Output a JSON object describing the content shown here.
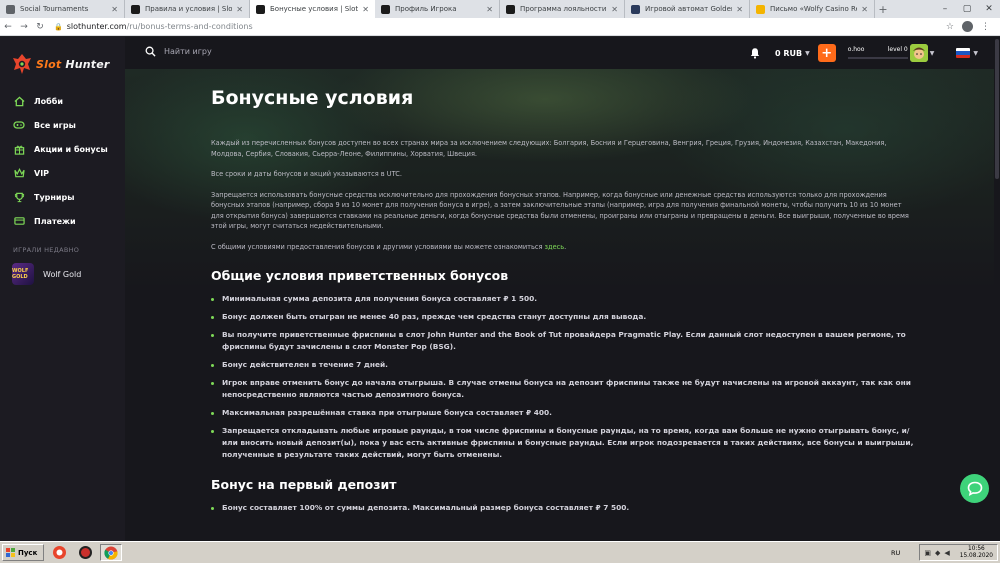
{
  "browser": {
    "tabs": [
      {
        "title": "Social Tournaments",
        "favicon": "social-favicon",
        "active": false
      },
      {
        "title": "Правила и условия | Slot Hunte",
        "favicon": "slothunter-favicon",
        "active": false
      },
      {
        "title": "Бонусные условия | Slot Hunte",
        "favicon": "slothunter-favicon",
        "active": true
      },
      {
        "title": "Профиль Игрока",
        "favicon": "slothunter-favicon",
        "active": false
      },
      {
        "title": "Программа лояльности | Slot H",
        "favicon": "slothunter-favicon",
        "active": false
      },
      {
        "title": "Игровой автомат Golden Grimo",
        "favicon": "game-favicon",
        "active": false
      },
      {
        "title": "Письмо «Wolfy Casino Received",
        "favicon": "mail-favicon",
        "active": false
      }
    ],
    "url_domain": "slothunter.com",
    "url_path": "/ru/bonus-terms-and-conditions"
  },
  "sidebar": {
    "logo_part1": "Slot",
    "logo_part2": " Hunter",
    "items": [
      {
        "label": "Лобби",
        "icon": "home-icon"
      },
      {
        "label": "Все игры",
        "icon": "gamepad-icon"
      },
      {
        "label": "Акции и бонусы",
        "icon": "gift-icon"
      },
      {
        "label": "VIP",
        "icon": "crown-icon"
      },
      {
        "label": "Турниры",
        "icon": "trophy-icon"
      },
      {
        "label": "Платежи",
        "icon": "wallet-icon"
      }
    ],
    "recent_heading": "ИГРАЛИ НЕДАВНО",
    "recent_game": "Wolf Gold",
    "recent_thumb_text": "WOLF GOLD"
  },
  "header": {
    "search_placeholder": "Найти игру",
    "balance": "0 RUB",
    "username": "o.hoo",
    "level": "level 0",
    "level_progress": 0
  },
  "content": {
    "title": "Бонусные условия",
    "paragraphs": [
      "Каждый из перечисленных бонусов доступен во всех странах мира за исключением следующих: Болгария, Босния и Герцеговина, Венгрия, Греция, Грузия, Индонезия, Казахстан, Македония, Молдова, Сербия, Словакия, Сьерра-Леоне, Филиппины, Хорватия, Швеция.",
      "Все сроки и даты бонусов и акций указываются в UTC.",
      "Запрещается использовать бонусные средства исключительно для прохождения бонусных этапов. Например, когда бонусные или денежные средства используются только для прохождения бонусных этапов (например, сбора 9 из 10 монет для получения бонуса в игре), а затем заключительные этапы (например, игра для получения финальной монеты, чтобы получить 10 из 10 монет для открытия бонуса) завершаются ставками на реальные деньги, когда бонусные средства были отменены, проиграны или отыграны и превращены в деньги. Все выигрыши, полученные во время этой игры, могут считаться недействительными."
    ],
    "link_sentence": "С общими условиями предоставления бонусов и другими условиями вы можете ознакомиться ",
    "link_text": "здесь",
    "link_end": ".",
    "section1_title": "Общие условия приветственных бонусов",
    "section1_items": [
      "Минимальная сумма депозита для получения бонуса составляет ₽ 1 500.",
      "Бонус должен быть отыгран не менее 40 раз, прежде чем средства станут доступны для вывода.",
      "Вы получите приветственные фриспины в слот John Hunter and the Book of Tut провайдера Pragmatic Play. Если данный слот недоступен в вашем регионе, то фриспины будут зачислены в слот Monster Pop (BSG).",
      "Бонус действителен в течение 7 дней.",
      "Игрок вправе отменить бонус до начала отыгрыша. В случае отмены бонуса на депозит фриспины также не будут начислены на игровой аккаунт, так как они непосредственно являются частью депозитного бонуса.",
      "Максимальная разрешённая ставка при отыгрыше бонуса составляет ₽ 400.",
      "Запрещается откладывать любые игровые раунды, в том числе фриспины и бонусные раунды, на то время, когда вам больше не нужно отыгрывать бонус, и/или вносить новый депозит(ы), пока у вас есть активные фриспины и бонусные раунды. Если игрок подозревается в таких действиях, все бонусы и выигрыши, полученные в результате таких действий, могут быть отменены."
    ],
    "section2_title": "Бонус на первый депозит",
    "section2_items": [
      "Бонус составляет 100% от суммы депозита. Максимальный размер бонуса составляет ₽ 7 500."
    ]
  },
  "taskbar": {
    "start_label": "Пуск",
    "lang": "RU",
    "time": "10:56",
    "date": "15.08.2020"
  },
  "colors": {
    "accent_orange": "#ff6b1a",
    "accent_green": "#7ed957",
    "chat_green": "#3ed37a"
  }
}
